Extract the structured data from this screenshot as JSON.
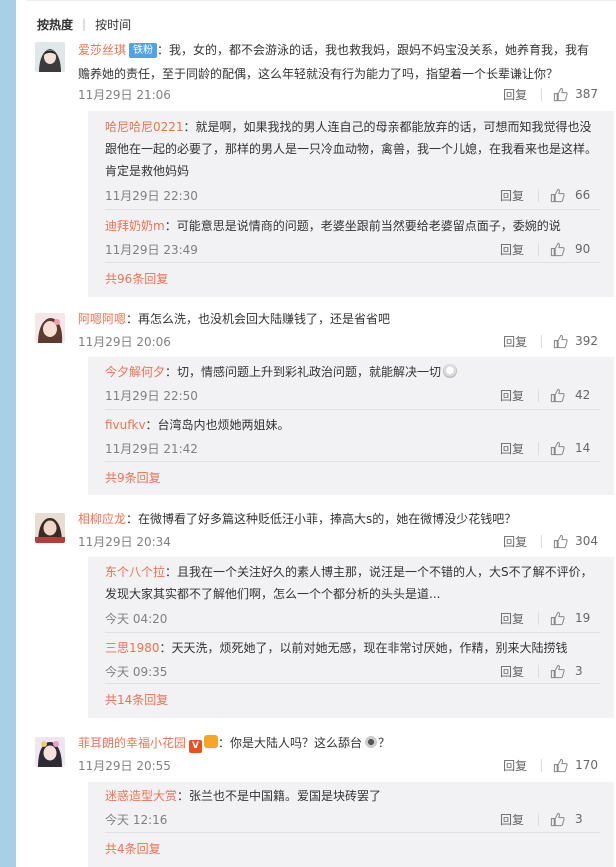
{
  "sort": {
    "hot": "按热度",
    "time": "按时间"
  },
  "labels": {
    "reply": "回复"
  },
  "comments": [
    {
      "user": "爱莎丝琪",
      "badge": "铁粉",
      "text": "：我，女的，都不会游泳的话，我也救我妈，跟妈不妈宝没关系，她养育我，我有赡养她的责任，至于同龄的配偶，这么年轻就没有行为能力了吗，指望着一个长辈谦让你？",
      "time": "11月29日 21:06",
      "likes": "387",
      "replies": [
        {
          "user": "哈尼哈尼0221",
          "text": "：就是啊，如果我找的男人连自己的母亲都能放弃的话，可想而知我觉得也没跟他在一起的必要了，那样的男人是一只冷血动物，禽兽，我一个儿媳，在我看来也是这样。肯定是救他妈妈",
          "time": "11月29日 22:30",
          "likes": "66"
        },
        {
          "user": "迪拜奶奶m",
          "text": "：可能意思是说情商的问题，老婆坐跟前当然要给老婆留点面子，委婉的说",
          "time": "11月29日 23:49",
          "likes": "90"
        }
      ],
      "more": "共96条回复"
    },
    {
      "user": "阿嗯阿嗯",
      "text": "：再怎么洗，也没机会回大陆赚钱了，还是省省吧",
      "time": "11月29日 20:06",
      "likes": "392",
      "replies": [
        {
          "user": "今夕解何夕",
          "text": "：切，情感问题上升到彩礼政治问题，就能解决一切",
          "time": "11月29日 22:50",
          "likes": "42"
        },
        {
          "user": "fivufkv",
          "text": "：台湾岛内也烦她两姐妹。",
          "time": "11月29日 21:42",
          "likes": "14"
        }
      ],
      "more": "共9条回复"
    },
    {
      "user": "相柳应龙",
      "text": "：在微博看了好多篇这种贬低汪小菲，捧高大s的，她在微博没少花钱吧？",
      "time": "11月29日 20:34",
      "likes": "304",
      "replies": [
        {
          "user": "东个八个拉",
          "text": "：且我在一个关注好久的素人博主那，说汪是一个不错的人，大S不了解不评价，发现大家其实都不了解他们啊，怎么一个个都分析的头头是道...",
          "time": "今天 04:20",
          "likes": "19"
        },
        {
          "user": "三思1980",
          "text": "：天天洗，烦死她了，以前对她无感，现在非常讨厌她，作精，别来大陆捞钱",
          "time": "今天 09:35",
          "likes": "3"
        }
      ],
      "more": "共14条回复"
    },
    {
      "user": "菲耳朗的幸福小花园",
      "text": "：你是大陆人吗？这么舔台",
      "time": "11月29日 20:55",
      "likes": "170",
      "replies": [
        {
          "user": "迷惑造型大赏",
          "text": "：张兰也不是中国籍。爱国是块砖罢了",
          "time": "今天 12:16",
          "likes": "3"
        }
      ],
      "more": "共4条回复"
    }
  ]
}
